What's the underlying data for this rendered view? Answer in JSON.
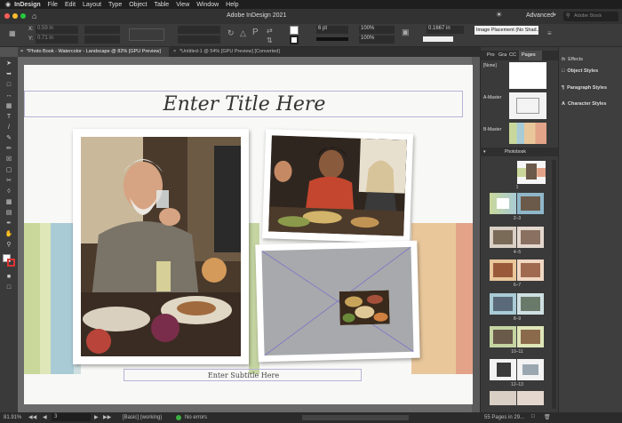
{
  "menu_bar": {
    "app_name": "InDesign",
    "items": [
      "File",
      "Edit",
      "Layout",
      "Type",
      "Object",
      "Table",
      "View",
      "Window",
      "Help"
    ]
  },
  "title_bar": {
    "title": "Adobe InDesign 2021",
    "workspace": "Advanced",
    "search_placeholder": "Adobe Stock"
  },
  "control_panel": {
    "x_value": "0.59 in",
    "y_value": "0.71 in",
    "stroke_weight": "6 pt",
    "zoom_pct_a": "100%",
    "zoom_pct_b": "100%",
    "stroke_value": "0.1667 in",
    "object_style": "Image Placement (No Shad..."
  },
  "doc_tabs": [
    {
      "label": "*Photo Book - Watercolor - Landscape @ 82% [GPU Preview]"
    },
    {
      "label": "*Untitled-1 @ 54% [GPU Preview] [Converted]"
    }
  ],
  "page": {
    "title_placeholder": "Enter Title Here",
    "subtitle_placeholder": "Enter Subtitle Here"
  },
  "stripe_colors": [
    "#c9d89a",
    "#dfe6b8",
    "#a9cbd5",
    "#cfe0e2",
    "#c5d5a2",
    "#e9c79b",
    "#e2a389",
    "#f2d6a6"
  ],
  "pages_panel": {
    "tabs": [
      "Pro",
      "Gra",
      "CC",
      "Pages"
    ],
    "active_tab": "Pages",
    "none_label": "[None]",
    "master_a": "A-Master",
    "master_b": "B-Master",
    "section_label": "Photobook",
    "spread_labels": [
      "1",
      "2–3",
      "4–5",
      "6–7",
      "8–9",
      "10–11",
      "12–13"
    ],
    "footer": "55 Pages in 29..."
  },
  "right_panel": {
    "items": [
      "Effects",
      "Object Styles",
      "Paragraph Styles",
      "Character Styles"
    ]
  },
  "status_bar": {
    "zoom": "81.91%",
    "page": "3",
    "profile": "[Basic] (working)",
    "preflight": "No errors"
  }
}
